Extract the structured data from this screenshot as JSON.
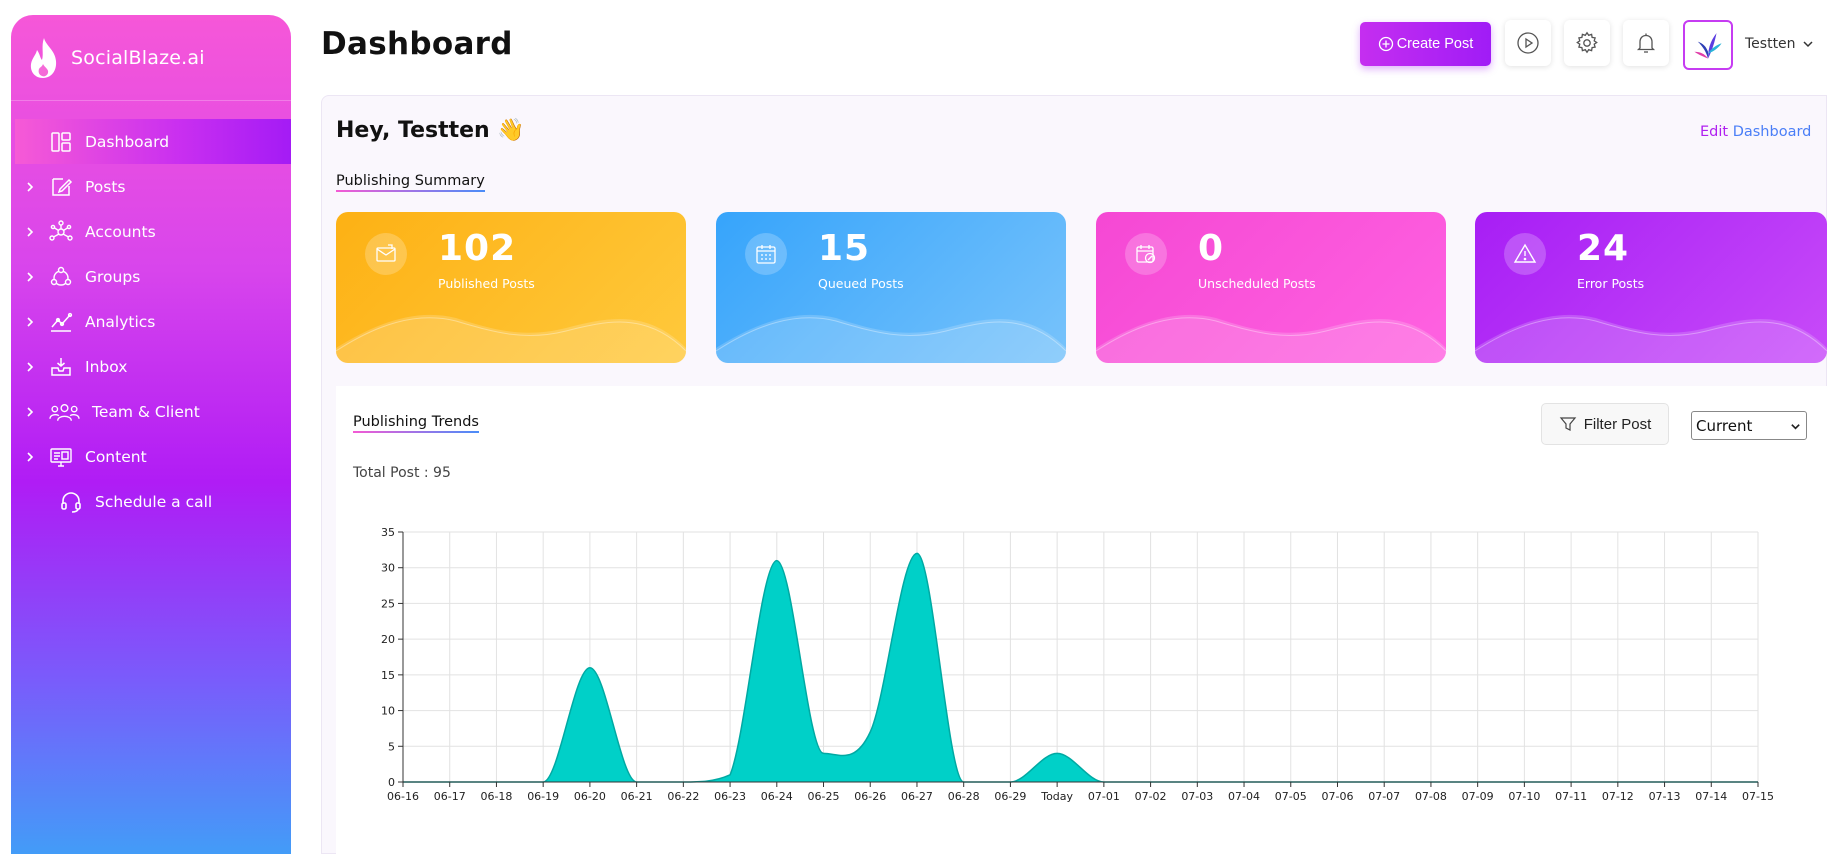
{
  "brand": {
    "name": "SocialBlaze.ai"
  },
  "sidebar": {
    "items": [
      {
        "label": "Dashboard",
        "icon": "dashboard-icon",
        "active": true,
        "expandable": false
      },
      {
        "label": "Posts",
        "icon": "edit-icon",
        "active": false,
        "expandable": true
      },
      {
        "label": "Accounts",
        "icon": "network-icon",
        "active": false,
        "expandable": true
      },
      {
        "label": "Groups",
        "icon": "groups-icon",
        "active": false,
        "expandable": true
      },
      {
        "label": "Analytics",
        "icon": "analytics-icon",
        "active": false,
        "expandable": true
      },
      {
        "label": "Inbox",
        "icon": "inbox-icon",
        "active": false,
        "expandable": true
      },
      {
        "label": "Team & Client",
        "icon": "team-icon",
        "active": false,
        "expandable": true
      },
      {
        "label": "Content",
        "icon": "content-icon",
        "active": false,
        "expandable": true
      },
      {
        "label": "Schedule a call",
        "icon": "headset-icon",
        "active": false,
        "expandable": false
      }
    ]
  },
  "header": {
    "title": "Dashboard",
    "create_label": "Create Post",
    "user_name": "Testten"
  },
  "main": {
    "greeting": "Hey, Testten 👋",
    "edit_label_1": "Edit",
    "edit_label_2": "Dashboard",
    "summary_title": "Publishing Summary",
    "cards": [
      {
        "value": "102",
        "label": "Published Posts",
        "icon": "mail-icon",
        "color_from": "#fbb316",
        "color_to": "#ffcb3d"
      },
      {
        "value": "15",
        "label": "Queued Posts",
        "icon": "calendar-icon",
        "color_from": "#3aa6fb",
        "color_to": "#71c0fb"
      },
      {
        "value": "0",
        "label": "Unscheduled Posts",
        "icon": "calendar-edit-icon",
        "color_from": "#f64ad6",
        "color_to": "#ff5fe0"
      },
      {
        "value": "24",
        "label": "Error Posts",
        "icon": "warning-icon",
        "color_from": "#a91ff5",
        "color_to": "#c646f9"
      }
    ],
    "trends_title": "Publishing Trends",
    "filter_label": "Filter Post",
    "period_selected": "Current",
    "total_label": "Total Post : 95"
  },
  "chart_data": {
    "type": "area",
    "categories": [
      "06-16",
      "06-17",
      "06-18",
      "06-19",
      "06-20",
      "06-21",
      "06-22",
      "06-23",
      "06-24",
      "06-25",
      "06-26",
      "06-27",
      "06-28",
      "06-29",
      "Today",
      "07-01",
      "07-02",
      "07-03",
      "07-04",
      "07-05",
      "07-06",
      "07-07",
      "07-08",
      "07-09",
      "07-10",
      "07-11",
      "07-12",
      "07-13",
      "07-14",
      "07-15"
    ],
    "values": [
      0,
      0,
      0,
      0,
      16,
      0,
      0,
      1,
      31,
      4,
      7,
      32,
      0,
      0,
      4,
      0,
      0,
      0,
      0,
      0,
      0,
      0,
      0,
      0,
      0,
      0,
      0,
      0,
      0,
      0
    ],
    "ylim": [
      0,
      35
    ],
    "yticks": [
      0,
      5,
      10,
      15,
      20,
      25,
      30,
      35
    ],
    "grid": true,
    "color": "#00d0c8",
    "line_color": "#00a9a3"
  }
}
